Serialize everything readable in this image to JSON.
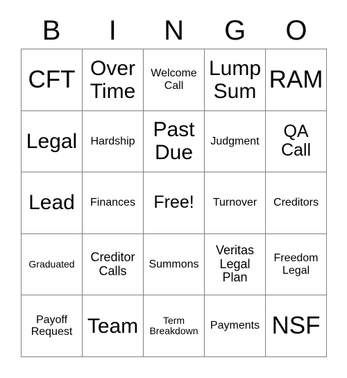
{
  "card": {
    "title": "BINGO",
    "headers": [
      "B",
      "I",
      "N",
      "G",
      "O"
    ],
    "free_space_label": "Free!",
    "rows": [
      [
        {
          "label": "CFT",
          "size": "xl"
        },
        {
          "label": "Over Time",
          "size": "lg"
        },
        {
          "label": "Welcome Call",
          "size": "xs"
        },
        {
          "label": "Lump Sum",
          "size": "lg"
        },
        {
          "label": "RAM",
          "size": "xl"
        }
      ],
      [
        {
          "label": "Legal",
          "size": "lg"
        },
        {
          "label": "Hardship",
          "size": "xs"
        },
        {
          "label": "Past Due",
          "size": "lg"
        },
        {
          "label": "Judgment",
          "size": "xs"
        },
        {
          "label": "QA Call",
          "size": "md"
        }
      ],
      [
        {
          "label": "Lead",
          "size": "lg"
        },
        {
          "label": "Finances",
          "size": "xs"
        },
        {
          "label": "Free!",
          "size": "md"
        },
        {
          "label": "Turnover",
          "size": "xs"
        },
        {
          "label": "Creditors",
          "size": "xs"
        }
      ],
      [
        {
          "label": "Graduated",
          "size": "xxs"
        },
        {
          "label": "Creditor Calls",
          "size": "sm"
        },
        {
          "label": "Summons",
          "size": "xs"
        },
        {
          "label": "Veritas Legal Plan",
          "size": "sm"
        },
        {
          "label": "Freedom Legal",
          "size": "xs"
        }
      ],
      [
        {
          "label": "Payoff Request",
          "size": "xs"
        },
        {
          "label": "Team",
          "size": "lg"
        },
        {
          "label": "Term Breakdown",
          "size": "xxs"
        },
        {
          "label": "Payments",
          "size": "xs"
        },
        {
          "label": "NSF",
          "size": "xl"
        }
      ]
    ]
  },
  "colors": {
    "background": "#ffffff",
    "text": "#000000",
    "grid_line": "#808080"
  }
}
